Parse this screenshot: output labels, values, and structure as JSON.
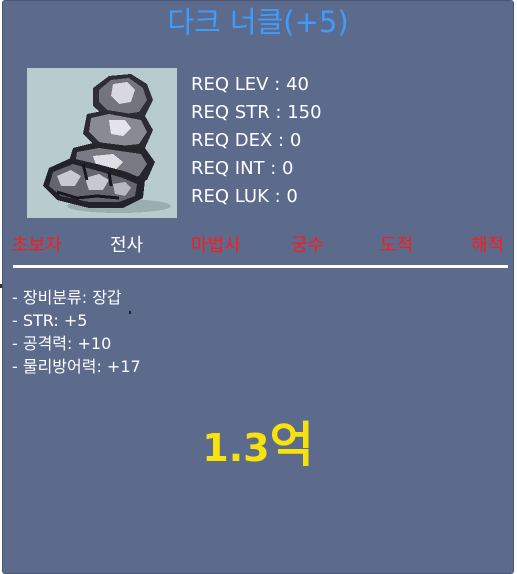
{
  "item": {
    "name": "다크 너클(+5)",
    "image_icon": "dark-knuckle-glove-icon"
  },
  "requirements": [
    "REQ LEV : 40",
    "REQ STR : 150",
    "REQ DEX : 0",
    "REQ INT : 0",
    "REQ LUK : 0"
  ],
  "jobs": [
    {
      "label": "초보자",
      "usable": false
    },
    {
      "label": "전사",
      "usable": true
    },
    {
      "label": "마법사",
      "usable": false
    },
    {
      "label": "궁수",
      "usable": false
    },
    {
      "label": "도적",
      "usable": false
    },
    {
      "label": "해적",
      "usable": false
    }
  ],
  "stats": [
    "- 장비분류: 장갑",
    "- STR: +5",
    "- 공격력: +10",
    "- 물리방어력: +17"
  ],
  "price": {
    "amount": "1.3",
    "unit": "억"
  },
  "colors": {
    "background": "#5c6a8c",
    "title": "#3d9cff",
    "job_unavailable": "#ff1a1a",
    "job_available": "#ffffff",
    "price": "#f5e20f"
  }
}
